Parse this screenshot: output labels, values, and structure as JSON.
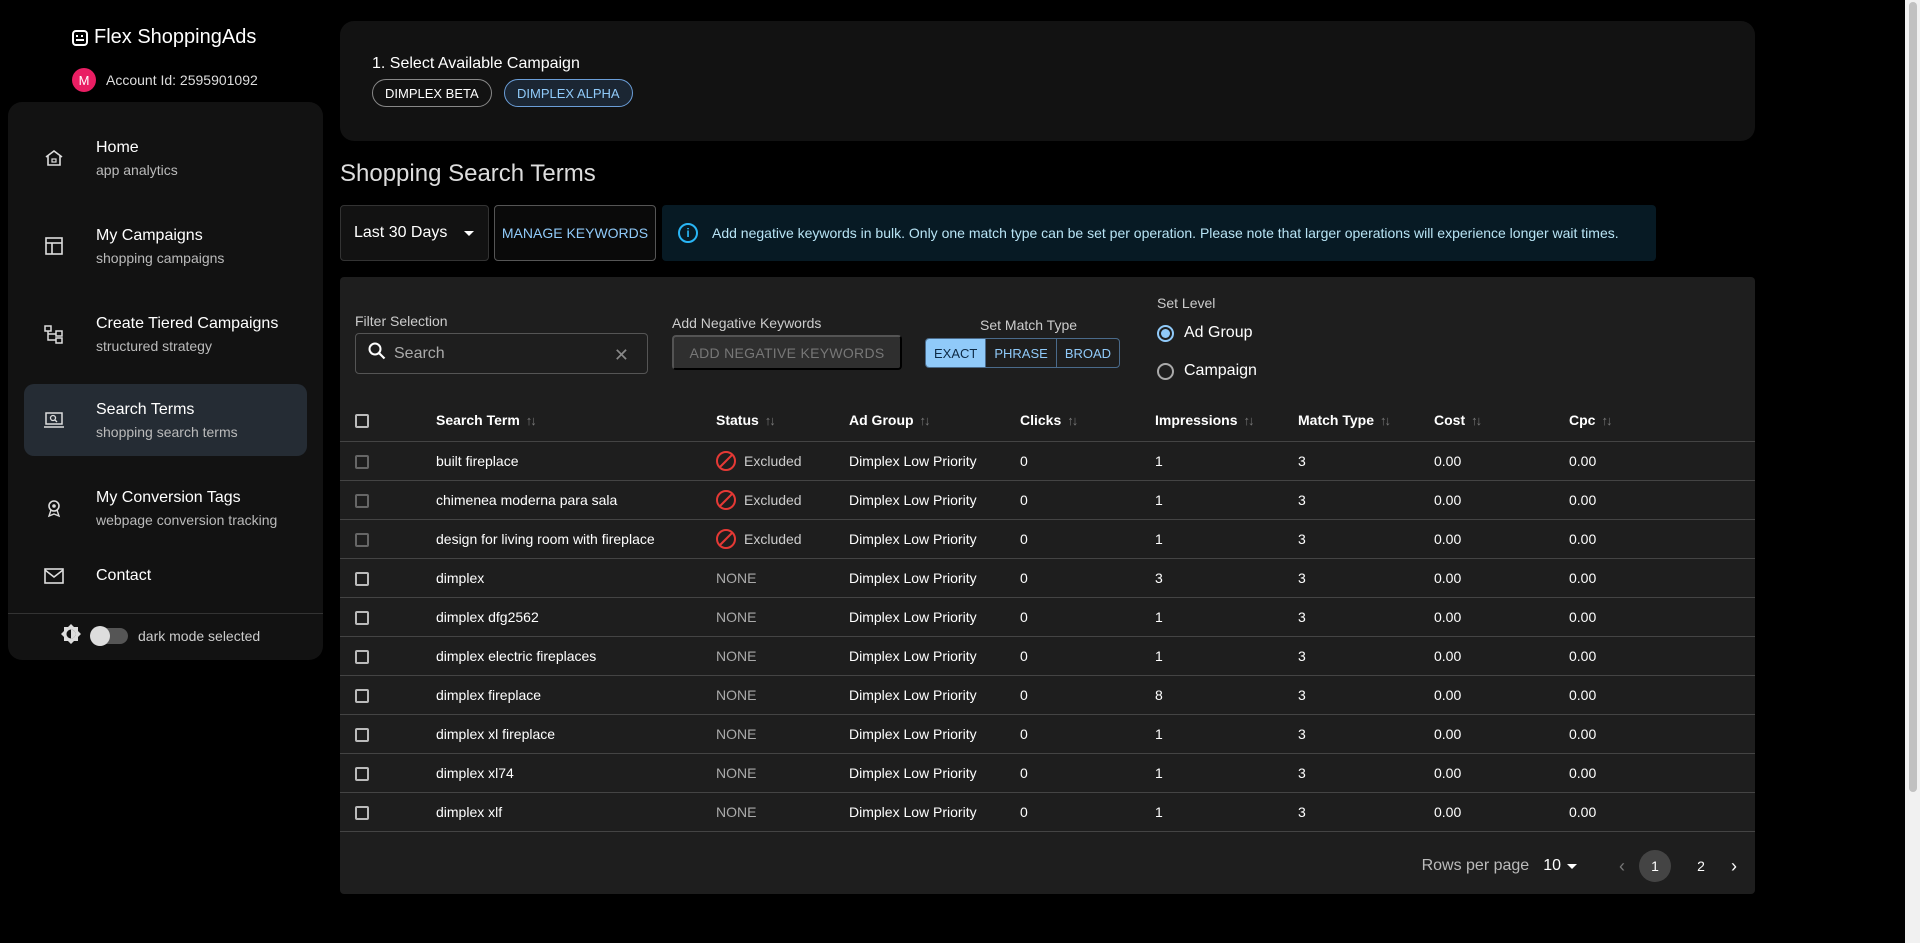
{
  "app": {
    "title": "Flex ShoppingAds",
    "account_label": "Account Id: 2595901092",
    "avatar_initial": "M"
  },
  "sidebar": {
    "items": [
      {
        "title": "Home",
        "subtitle": "app analytics",
        "icon": "home-icon"
      },
      {
        "title": "My Campaigns",
        "subtitle": "shopping campaigns",
        "icon": "campaigns-icon"
      },
      {
        "title": "Create Tiered Campaigns",
        "subtitle": "structured strategy",
        "icon": "tiered-icon"
      },
      {
        "title": "Search Terms",
        "subtitle": "shopping search terms",
        "icon": "search-terms-icon",
        "active": true
      },
      {
        "title": "My Conversion Tags",
        "subtitle": "webpage conversion tracking",
        "icon": "conversion-icon"
      },
      {
        "title": "Contact",
        "subtitle": "",
        "icon": "mail-icon"
      }
    ],
    "mode_label": "dark mode selected"
  },
  "campaign": {
    "label": "1. Select Available Campaign",
    "chips": [
      "DIMPLEX BETA",
      "DIMPLEX ALPHA"
    ],
    "selected": "DIMPLEX ALPHA"
  },
  "page_title": "Shopping Search Terms",
  "toolbar": {
    "date_range": "Last 30 Days",
    "manage_label": "MANAGE KEYWORDS",
    "alert_text": "Add negative keywords in bulk. Only one match type can be set per operation. Please note that larger operations will experience longer wait times."
  },
  "filters": {
    "filter_label": "Filter Selection",
    "search_placeholder": "Search",
    "neg_label": "Add Negative Keywords",
    "neg_button": "ADD NEGATIVE KEYWORDS",
    "match_label": "Set Match Type",
    "match_types": [
      "EXACT",
      "PHRASE",
      "BROAD"
    ],
    "match_selected": "EXACT",
    "level_label": "Set Level",
    "levels": [
      "Ad Group",
      "Campaign"
    ],
    "level_selected": "Ad Group"
  },
  "table": {
    "columns": [
      "Search Term",
      "Status",
      "Ad Group",
      "Clicks",
      "Impressions",
      "Match Type",
      "Cost",
      "Cpc"
    ],
    "rows": [
      {
        "term": "built fireplace",
        "status": "Excluded",
        "ad_group": "Dimplex Low Priority",
        "clicks": "0",
        "impressions": "1",
        "match": "3",
        "cost": "0.00",
        "cpc": "0.00"
      },
      {
        "term": "chimenea moderna para sala",
        "status": "Excluded",
        "ad_group": "Dimplex Low Priority",
        "clicks": "0",
        "impressions": "1",
        "match": "3",
        "cost": "0.00",
        "cpc": "0.00"
      },
      {
        "term": "design for living room with fireplace",
        "status": "Excluded",
        "ad_group": "Dimplex Low Priority",
        "clicks": "0",
        "impressions": "1",
        "match": "3",
        "cost": "0.00",
        "cpc": "0.00"
      },
      {
        "term": "dimplex",
        "status": "NONE",
        "ad_group": "Dimplex Low Priority",
        "clicks": "0",
        "impressions": "3",
        "match": "3",
        "cost": "0.00",
        "cpc": "0.00"
      },
      {
        "term": "dimplex dfg2562",
        "status": "NONE",
        "ad_group": "Dimplex Low Priority",
        "clicks": "0",
        "impressions": "1",
        "match": "3",
        "cost": "0.00",
        "cpc": "0.00"
      },
      {
        "term": "dimplex electric fireplaces",
        "status": "NONE",
        "ad_group": "Dimplex Low Priority",
        "clicks": "0",
        "impressions": "1",
        "match": "3",
        "cost": "0.00",
        "cpc": "0.00"
      },
      {
        "term": "dimplex fireplace",
        "status": "NONE",
        "ad_group": "Dimplex Low Priority",
        "clicks": "0",
        "impressions": "8",
        "match": "3",
        "cost": "0.00",
        "cpc": "0.00"
      },
      {
        "term": "dimplex xl fireplace",
        "status": "NONE",
        "ad_group": "Dimplex Low Priority",
        "clicks": "0",
        "impressions": "1",
        "match": "3",
        "cost": "0.00",
        "cpc": "0.00"
      },
      {
        "term": "dimplex xl74",
        "status": "NONE",
        "ad_group": "Dimplex Low Priority",
        "clicks": "0",
        "impressions": "1",
        "match": "3",
        "cost": "0.00",
        "cpc": "0.00"
      },
      {
        "term": "dimplex xlf",
        "status": "NONE",
        "ad_group": "Dimplex Low Priority",
        "clicks": "0",
        "impressions": "1",
        "match": "3",
        "cost": "0.00",
        "cpc": "0.00"
      }
    ]
  },
  "pagination": {
    "rows_label": "Rows per page",
    "rows_value": "10",
    "pages": [
      "1",
      "2"
    ],
    "current": "1"
  },
  "colors": {
    "accent": "#90caf9",
    "danger": "#e53935",
    "avatar": "#e91e63"
  }
}
